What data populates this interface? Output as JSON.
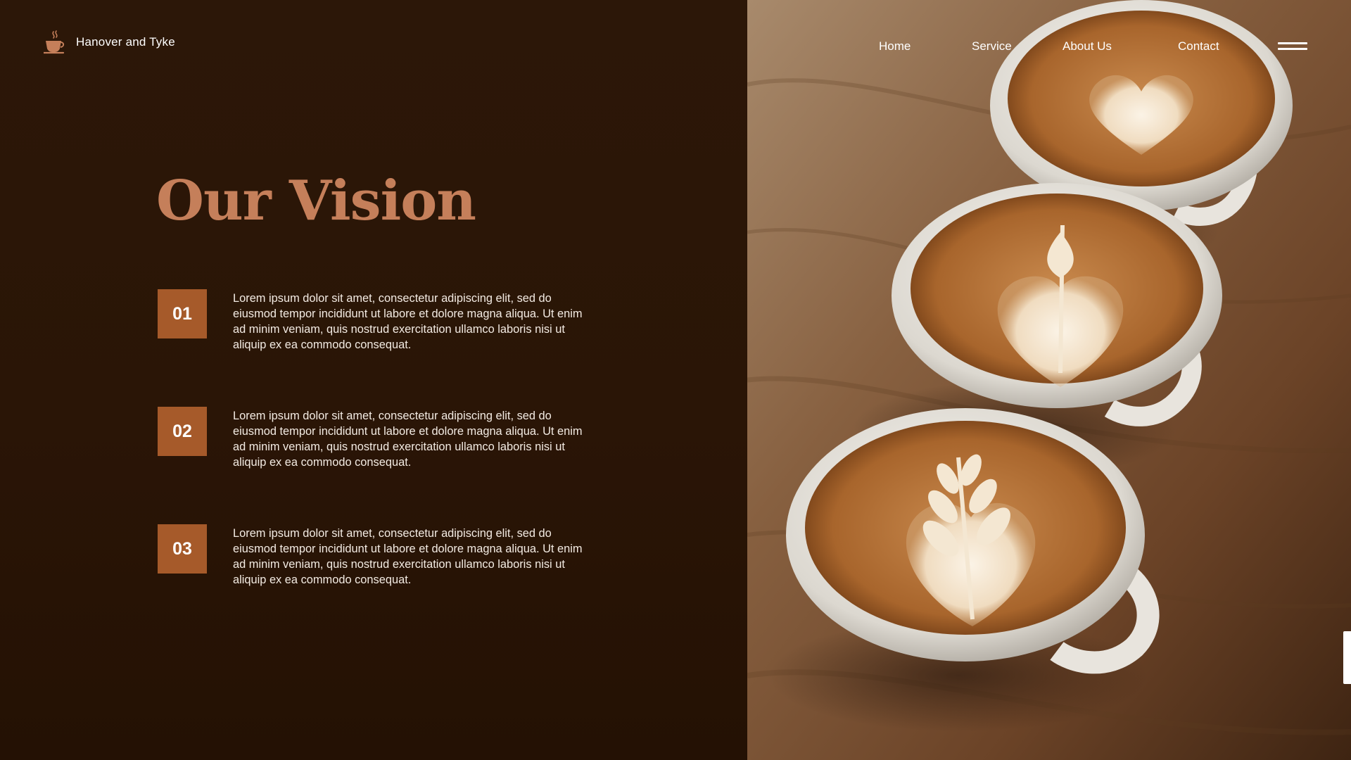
{
  "header": {
    "brand_name": "Hanover and Tyke",
    "logo_icon": "coffee-cup-icon",
    "nav": [
      {
        "label": "Home"
      },
      {
        "label": "Service"
      },
      {
        "label": "About Us"
      },
      {
        "label": "Contact"
      }
    ],
    "menu_icon": "hamburger-menu-icon"
  },
  "main": {
    "title": "Our Vision",
    "items": [
      {
        "number": "01",
        "text": "Lorem ipsum dolor sit amet, consectetur adipiscing elit, sed do eiusmod tempor incididunt ut labore et dolore magna aliqua. Ut enim ad minim veniam, quis nostrud exercitation ullamco laboris nisi ut aliquip ex ea commodo consequat."
      },
      {
        "number": "02",
        "text": "Lorem ipsum dolor sit amet, consectetur adipiscing elit, sed do eiusmod tempor incididunt ut labore et dolore magna aliqua. Ut enim ad minim veniam, quis nostrud exercitation ullamco laboris nisi ut aliquip ex ea commodo consequat."
      },
      {
        "number": "03",
        "text": "Lorem ipsum dolor sit amet, consectetur adipiscing elit, sed do eiusmod tempor incididunt ut labore et dolore magna aliqua. Ut enim ad minim veniam, quis nostrud exercitation ullamco laboris nisi ut aliquip ex ea commodo consequat."
      }
    ]
  },
  "colors": {
    "background": "#2a1607",
    "accent": "#a65a2a",
    "title": "#c57f5a",
    "text": "#f3ebe3"
  },
  "photo": {
    "subject": "three-latte-cups-on-wooden-table"
  }
}
